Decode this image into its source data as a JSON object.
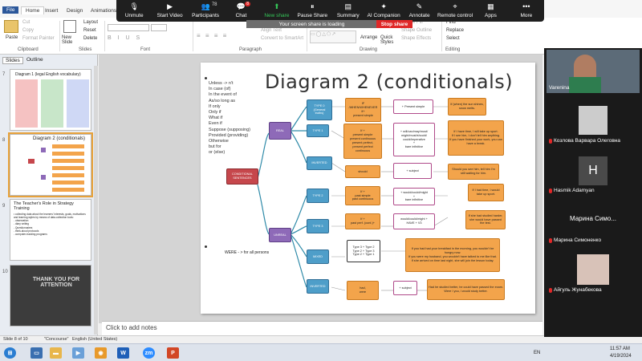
{
  "zoom": {
    "items": [
      {
        "label": "Unmute",
        "icon": "mic-off-icon"
      },
      {
        "label": "Start Video",
        "icon": "video-off-icon"
      },
      {
        "label": "Participants",
        "icon": "participants-icon",
        "count": "78"
      },
      {
        "label": "Chat",
        "icon": "chat-icon",
        "badge": "8"
      },
      {
        "label": "New share",
        "icon": "share-icon"
      },
      {
        "label": "Pause Share",
        "icon": "pause-icon"
      },
      {
        "label": "Summary",
        "icon": "summary-icon"
      },
      {
        "label": "AI Companion",
        "icon": "ai-companion-icon"
      },
      {
        "label": "Annotate",
        "icon": "annotate-icon"
      },
      {
        "label": "Remote control",
        "icon": "remote-control-icon"
      },
      {
        "label": "Apps",
        "icon": "apps-icon"
      },
      {
        "label": "More",
        "icon": "more-icon"
      }
    ],
    "share_status": "Your screen share is loading",
    "stop_share": "Stop share"
  },
  "ribbon": {
    "tabs": [
      "Home",
      "Insert",
      "Design",
      "Animations"
    ],
    "paste": "Paste",
    "cut": "Cut",
    "copy": "Copy",
    "format_painter": "Format Painter",
    "new_slide": "New Slide",
    "layout": "Layout",
    "reset": "Reset",
    "delete": "Delete",
    "align_text": "Align Text",
    "convert": "Convert to SmartArt",
    "text_direction": "Text Direction",
    "arrange": "Arrange",
    "quick_styles": "Quick Styles",
    "shape_fill": "Shape Fill",
    "shape_outline": "Shape Outline",
    "shape_effects": "Shape Effects",
    "find": "Find",
    "replace": "Replace",
    "select": "Select",
    "groups": {
      "clipboard": "Clipboard",
      "slides": "Slides",
      "font": "Font",
      "paragraph": "Paragraph",
      "drawing": "Drawing",
      "editing": "Editing"
    }
  },
  "panel": {
    "tabs": [
      "Slides",
      "Outline"
    ],
    "thumb1_title": "Diagram 1 (legal English vocabulary)",
    "thumb2_title": "Diagram 2 (conditionals)",
    "thumb3_title": "The Teacher's Role in Strategy Training",
    "thumb3_body": "• collecting data about the learners' interests, goals, motivations and learning styles by means of data-collection tools:\n  - observation\n  - diary writing\n  - Questionnaires\n  - think-aloud protocols\n  - computer-tracking programs",
    "thumb4_text": "THANK YOU FOR ATTENTION"
  },
  "slide": {
    "title": "Diagram 2 (conditionals)",
    "conjunctions": "Unless -> n't\nIn case (of)\nIn the event of\nAs/so long as\nIf only\nOnly if\nWhat if\nEven if\nSuppose (supposing)\nProvided (providing)\nOtherwise\nbut for\nor (else)",
    "were_note": "WERE - > for all persons",
    "boxes": {
      "conditional": "CONDITIONAL\nSENTENCES",
      "real": "REAL",
      "unreal": "UNREAL",
      "type0": "TYPE 0\n(General\ntruths)",
      "type0_if": "IF\n/WHEN/WHENEVER\nif+\npresent simple",
      "type0_res": "+ Present simple",
      "type0_ex": "If (when) the sun shines, snow melts.",
      "type1": "TYPE 1",
      "type1_if": "If +\npresent simple\npresent continuous\npresent perfect,\npresent perfect\ncontinuous",
      "type1_res": "+ will/can/may/must/\nmight/must/should/\ncould/imperative\n+\nbare infinitive",
      "type1_ex": "If I have time, I will take up sport.\nIf I see him, I don't tell him anything.\nIf you have finished your work, you can have a break.",
      "inverted1": "INVERTED",
      "should": "should",
      "subject1": "+ subject",
      "inverted1_ex": "Should you see him, tell him I'm still waiting for him.",
      "type2": "TYPE 2",
      "type2_if": "If +\npast simple\npast continuous",
      "type2_res": "+ would/could/might\n+\nbare infinitive",
      "type2_ex": "If I had time, I would take up sport.",
      "type3": "TYPE 3",
      "type3_if": "If +\npast perf. (cont.)+",
      "type3_res": "would/could/might +\nHAVE + V3",
      "type3_ex": "If she had studied harder, she would have passed the test.",
      "mixed": "MIXED",
      "mixed_types": "Type 3 + Type 2\nType 2 + Type 3\nType 2 + Type 1",
      "mixed_ex": "If you had had your breakfast in the morning, you wouldn't be hungry now.\nIf you were my husband, you wouldn't have talked to me like that.\nIf she arrived on time last night, she will join the lesson today.",
      "inverted2": "INVERTED",
      "had_were": "had,\nwere",
      "subject2": "+ subject",
      "inverted2_ex": "Had he studied better, he could have passed the exam.\nWere I you, I would study better."
    }
  },
  "notes_placeholder": "Click to add notes",
  "status": {
    "slide": "Slide 8 of 10",
    "theme": "\"Concourse\"",
    "language": "English (United States)"
  },
  "participants": [
    {
      "name": "Varenina",
      "type": "video",
      "muted": false
    },
    {
      "name": "Козлова Варвара Олеговна",
      "type": "photo",
      "muted": true
    },
    {
      "name": "Hasmik Adamyan",
      "type": "avatar",
      "initial": "H",
      "muted": true
    },
    {
      "name": "Марина Симоненко",
      "type": "text",
      "display": "Марина Симо...",
      "muted": true
    },
    {
      "name": "Айгуль Жунабекова",
      "type": "photo",
      "muted": true
    }
  ],
  "clock": {
    "time": "11:57 AM",
    "date": "4/19/2024",
    "lang": "EN"
  }
}
